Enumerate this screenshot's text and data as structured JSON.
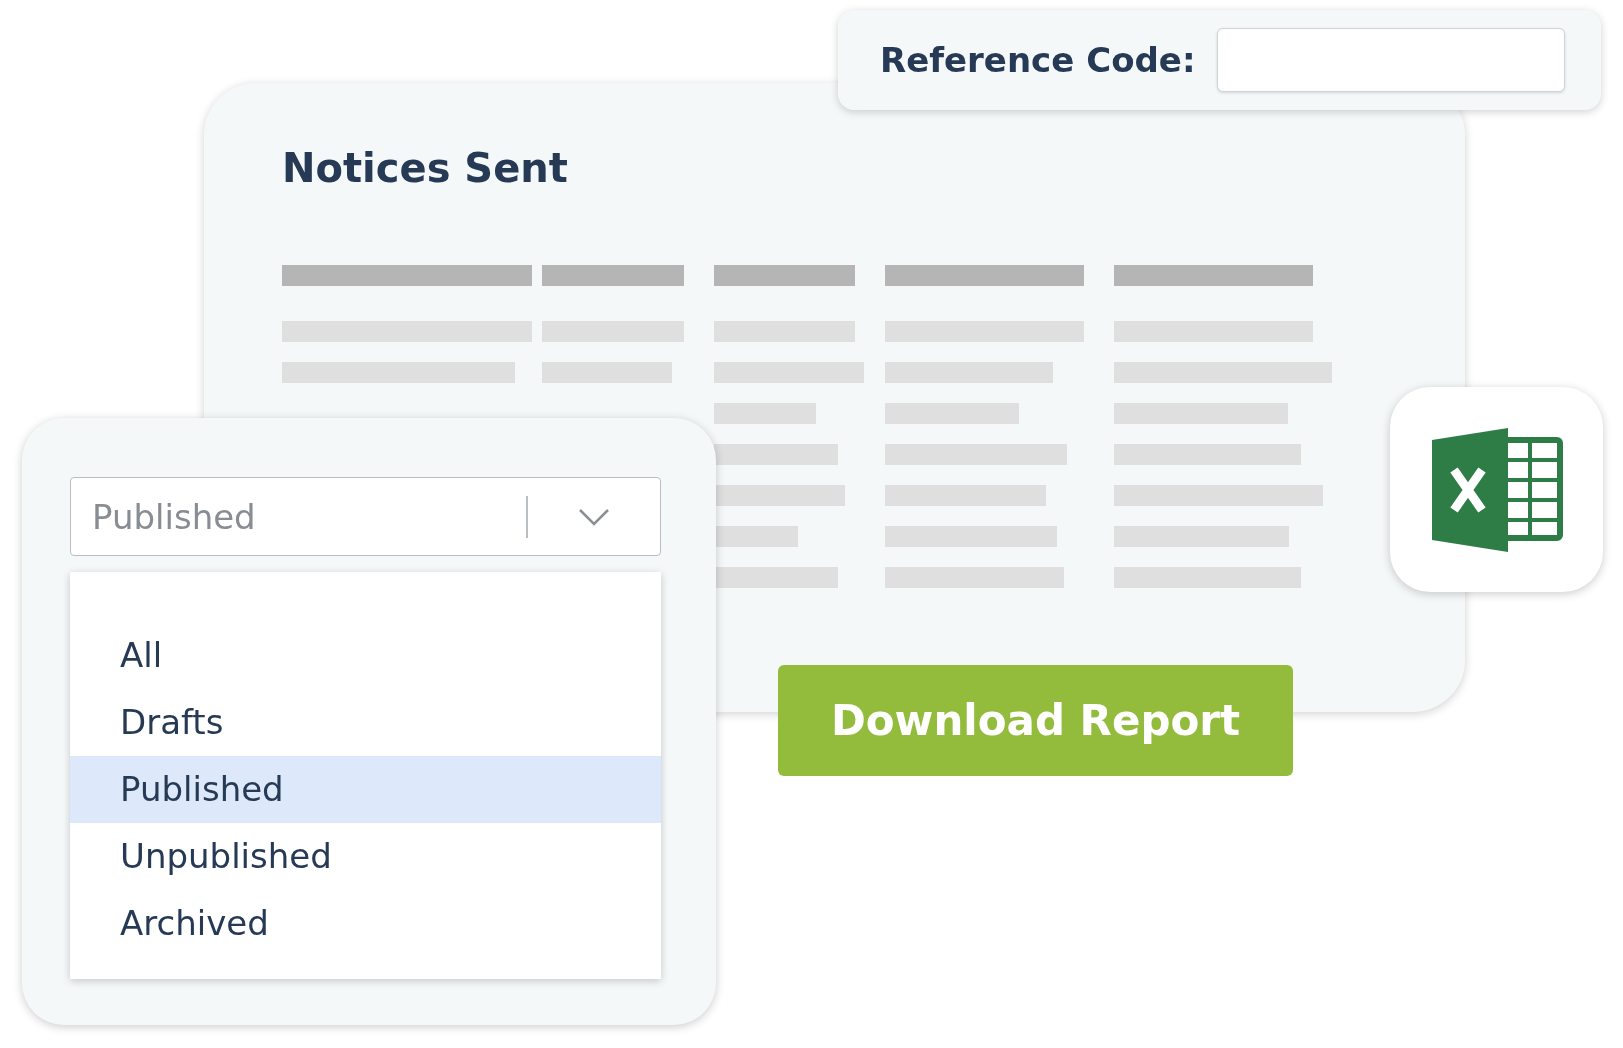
{
  "reference": {
    "label": "Reference Code:"
  },
  "card": {
    "title": "Notices Sent"
  },
  "filter": {
    "value": "Published",
    "options": [
      {
        "label": "All",
        "selected": false
      },
      {
        "label": "Drafts",
        "selected": false
      },
      {
        "label": "Published",
        "selected": true
      },
      {
        "label": "Unpublished",
        "selected": false
      },
      {
        "label": "Archived",
        "selected": false
      }
    ]
  },
  "download_button": {
    "label": "Download Report"
  }
}
